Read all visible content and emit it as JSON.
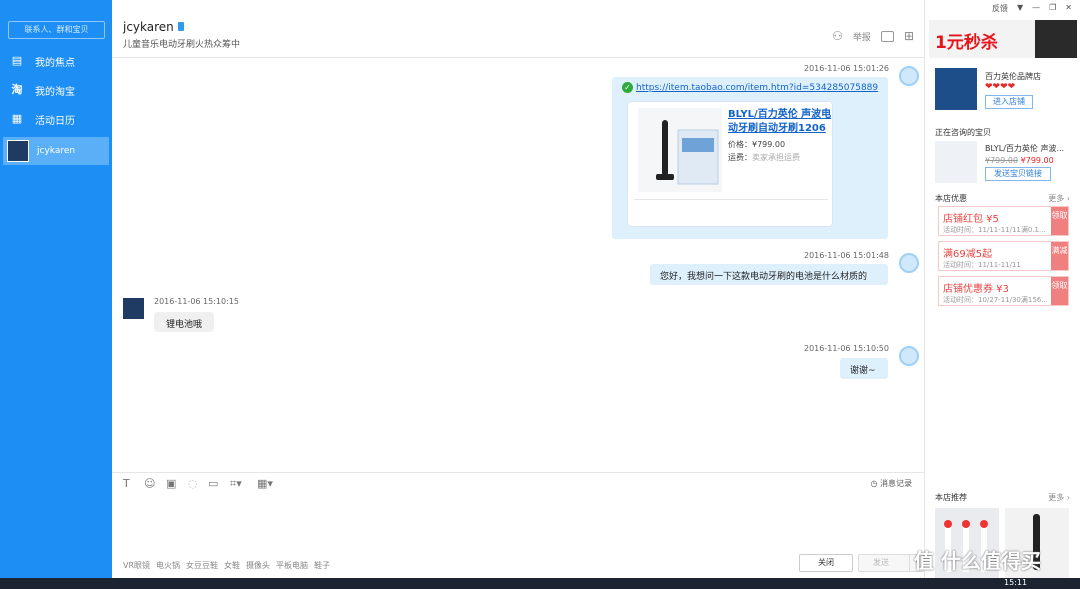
{
  "sidebar": {
    "search_placeholder": "联系人、群和宝贝",
    "items": [
      {
        "label": "我的焦点",
        "icon": "focus-icon"
      },
      {
        "label": "我的淘宝",
        "icon": "taobao-icon"
      },
      {
        "label": "活动日历",
        "icon": "calendar-icon"
      }
    ],
    "contact": {
      "name": "jcykaren"
    }
  },
  "chat_header": {
    "name": "jcykaren",
    "subtitle": "儿童音乐电动牙刷火热众筹中",
    "report_label": "举报"
  },
  "messages": [
    {
      "side": "right",
      "time": "2016-11-06 15:01:26",
      "link": "https://item.taobao.com/item.htm?id=534285075889",
      "card": {
        "title": "BLYL/百力英伦 声波电动牙刷自动牙刷1206",
        "price_label": "价格：",
        "price": "¥799.00",
        "ship_label": "运费：",
        "ship": "卖家承担运费"
      }
    },
    {
      "side": "right",
      "time": "2016-11-06 15:01:48",
      "text": "您好，我想问一下这款电动牙刷的电池是什么材质的"
    },
    {
      "side": "left",
      "time": "2016-11-06 15:10:15",
      "text": "锂电池哦"
    },
    {
      "side": "right",
      "time": "2016-11-06 15:10:50",
      "text": "谢谢~"
    }
  ],
  "toolbar": {
    "history_label": "消息记录"
  },
  "input": {
    "tags": [
      "VR眼镜",
      "电火锅",
      "女豆豆鞋",
      "女鞋",
      "摄像头",
      "平板电脑",
      "鞋子"
    ],
    "close_label": "关闭",
    "send_label": "发送"
  },
  "right_panel": {
    "feedback_label": "反馈",
    "banner_text": "1元秒杀",
    "shop": {
      "name": "百力英伦品牌店",
      "hearts": "❤❤❤❤",
      "enter_label": "进入店铺"
    },
    "consulting_title": "正在咨询的宝贝",
    "consulting": {
      "name": "BLYL/百力英伦 声波...",
      "old_price": "¥799.00",
      "price": "¥799.00",
      "send_link_label": "发送宝贝链接"
    },
    "offers_title": "本店优惠",
    "more_label": "更多",
    "coupons": [
      {
        "title": "店铺红包 ¥5",
        "date": "活动时间：11/11-11/11满0.1...",
        "get": "领取"
      },
      {
        "title": "满69减5起",
        "date": "活动时间：11/11-11/11",
        "get": "满减"
      },
      {
        "title": "店铺优惠券 ¥3",
        "date": "活动时间：10/27-11/30满156...",
        "get": "领取"
      }
    ],
    "recommend_title": "本店推荐"
  },
  "taskbar": {
    "clock": "15:11"
  },
  "watermark": "值 什么值得买"
}
